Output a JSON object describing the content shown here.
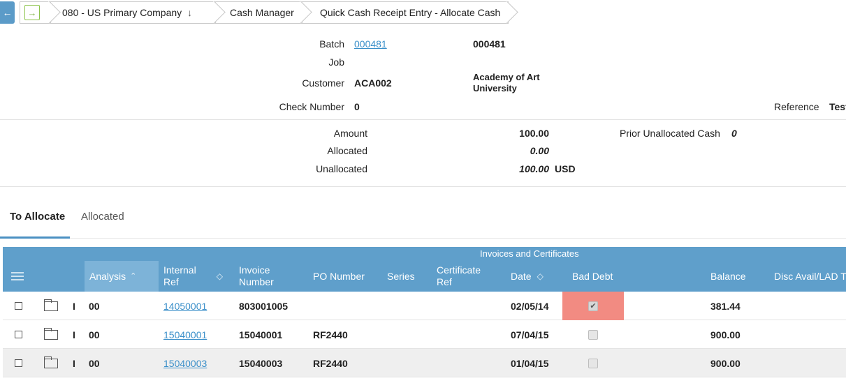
{
  "breadcrumb": {
    "company": "080 - US Primary Company",
    "module": "Cash Manager",
    "page": "Quick Cash Receipt Entry - Allocate Cash"
  },
  "header": {
    "batch_label": "Batch",
    "batch_link": "000481",
    "batch_value": "000481",
    "job_label": "Job",
    "customer_label": "Customer",
    "customer_code": "ACA002",
    "customer_name_line1": "Academy of Art",
    "customer_name_line2": "University",
    "check_label": "Check Number",
    "check_value": "0",
    "reference_label": "Reference",
    "reference_value": "Test"
  },
  "amounts": {
    "amount_label": "Amount",
    "amount_value": "100.00",
    "allocated_label": "Allocated",
    "allocated_value": "0.00",
    "unallocated_label": "Unallocated",
    "unallocated_value": "100.00",
    "currency": "USD",
    "prior_label": "Prior Unallocated Cash",
    "prior_value": "0"
  },
  "tabs": {
    "to_allocate": "To Allocate",
    "allocated": "Allocated"
  },
  "grid": {
    "group_title": "Invoices and Certificates",
    "columns": {
      "analysis": "Analysis",
      "internal_ref_1": "Internal",
      "internal_ref_2": "Ref",
      "invoice_1": "Invoice",
      "invoice_2": "Number",
      "po": "PO Number",
      "series": "Series",
      "cert_1": "Certificate",
      "cert_2": "Ref",
      "date": "Date",
      "bad_debt": "Bad Debt",
      "balance": "Balance",
      "disc": "Disc Avail/LAD T"
    },
    "rows": [
      {
        "type": "I",
        "analysis": "00",
        "internal_ref": "14050001",
        "invoice": "803001005",
        "po": "",
        "date": "02/05/14",
        "bad_debt": true,
        "balance": "381.44"
      },
      {
        "type": "I",
        "analysis": "00",
        "internal_ref": "15040001",
        "invoice": "15040001",
        "po": "RF2440",
        "date": "07/04/15",
        "bad_debt": false,
        "balance": "900.00"
      },
      {
        "type": "I",
        "analysis": "00",
        "internal_ref": "15040003",
        "invoice": "15040003",
        "po": "RF2440",
        "date": "01/04/15",
        "bad_debt": false,
        "balance": "900.00"
      }
    ]
  },
  "colors": {
    "grid_header": "#5f9fcb",
    "link": "#3a8fc9",
    "bad_debt_highlight": "#f28b82"
  }
}
